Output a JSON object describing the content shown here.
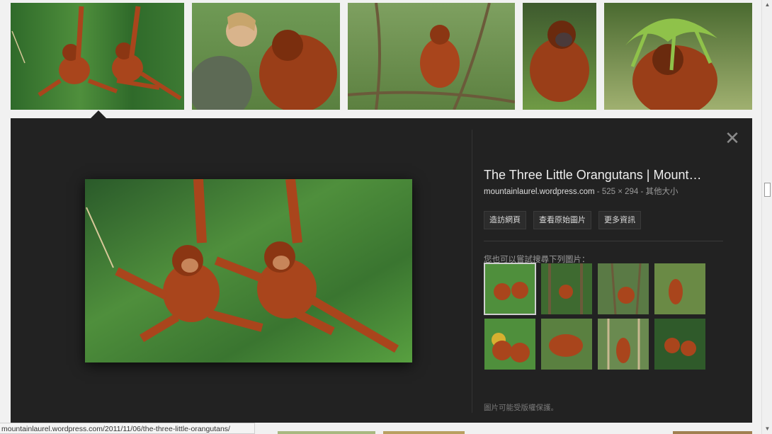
{
  "thumbnails": [
    {
      "name": "thumb-swinging-orangutans"
    },
    {
      "name": "thumb-woman-with-orangutan"
    },
    {
      "name": "thumb-orangutan-on-vine"
    },
    {
      "name": "thumb-sitting-orangutan"
    },
    {
      "name": "thumb-orangutan-leaf-hat"
    }
  ],
  "panel": {
    "title": "The Three Little Orangutans | Mount…",
    "domain": "mountainlaurel.wordpress.com",
    "meta": " - 525 × 294 - 其他大小",
    "buttons": {
      "visit": "造訪網頁",
      "view_original": "查看原始圖片",
      "more_info": "更多資訊"
    },
    "related_label": "您也可以嘗試搜尋下列圖片：",
    "notice": "圖片可能受版權保護。",
    "close_symbol": "✕"
  },
  "status_url": "mountainlaurel.wordpress.com/2011/11/06/the-three-little-orangutans/",
  "colors": {
    "panel_bg": "#222222",
    "orangutan": "#a9451c",
    "foliage": "#3f7a2e"
  }
}
